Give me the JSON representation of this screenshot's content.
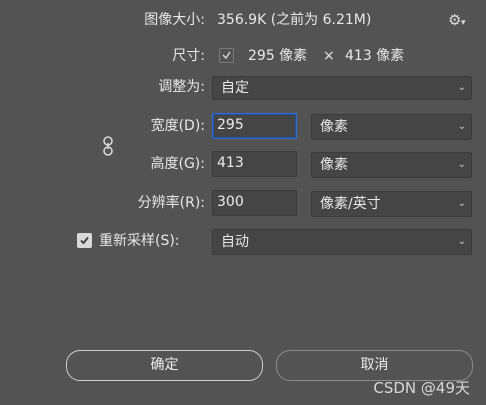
{
  "header": {
    "image_size_label": "图像大小:",
    "image_size_value": "356.9K (之前为 6.21M)",
    "settings_icon": "gear-icon"
  },
  "dimensions": {
    "label": "尺寸:",
    "width_value": "295 像素",
    "times_symbol": "×",
    "height_value": "413 像素"
  },
  "fit_to": {
    "label": "调整为:",
    "value": "自定"
  },
  "width": {
    "label": "宽度(D):",
    "value": "295",
    "unit": "像素"
  },
  "height": {
    "label": "高度(G):",
    "value": "413",
    "unit": "像素"
  },
  "resolution": {
    "label": "分辨率(R):",
    "value": "300",
    "unit": "像素/英寸"
  },
  "resample": {
    "checked": true,
    "label": "重新采样(S):",
    "value": "自动"
  },
  "buttons": {
    "ok_label": "确定",
    "cancel_label": "取消"
  },
  "watermark": "CSDN @49天",
  "colors": {
    "background": "#535353",
    "field_bg": "#454545",
    "focus_border": "#2f6ed6"
  }
}
